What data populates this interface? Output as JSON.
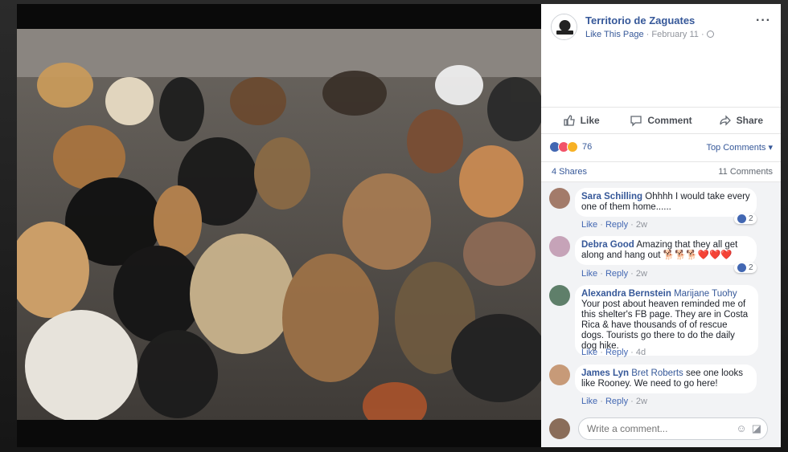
{
  "post": {
    "page_name": "Territorio de Zaguates",
    "like_page": "Like This Page",
    "date": "February 11",
    "sep": "·",
    "more": "···"
  },
  "actions": {
    "like": "Like",
    "comment": "Comment",
    "share": "Share"
  },
  "reactions": {
    "count": "76",
    "top_comments": "Top Comments ▾",
    "shares": "4 Shares",
    "comments_count": "11 Comments"
  },
  "comments": [
    {
      "name": "Sara Schilling",
      "mention": "",
      "text": "Ohhhh I would take every one of them home......",
      "like": "Like",
      "reply": "Reply",
      "age": "2w",
      "reactions": "2"
    },
    {
      "name": "Debra Good",
      "mention": "",
      "text": "Amazing that they all get along and hang out 🐕🐕🐕❤️❤️❤️",
      "like": "Like",
      "reply": "Reply",
      "age": "2w",
      "reactions": "2"
    },
    {
      "name": "Alexandra Bernstein",
      "mention": "Marijane Tuohy",
      "text": "Your post about heaven reminded me of this shelter's FB page. They are in Costa Rica & have thousands of of rescue dogs. Tourists go there to do the daily dog hike.",
      "like": "Like",
      "reply": "Reply",
      "age": "4d"
    },
    {
      "name": "James Lyn",
      "mention": "Bret Roberts",
      "text": "see one looks like Rooney. We need to go here!",
      "like": "Like",
      "reply": "Reply",
      "age": "2w"
    }
  ],
  "composer": {
    "placeholder": "Write a comment..."
  },
  "colors": {
    "link": "#365899",
    "like_blue": "#4267b2",
    "love_red": "#f25268",
    "haha_yellow": "#f7b125"
  },
  "icons": [
    "thumbs-up-icon",
    "comment-icon",
    "share-icon",
    "globe-icon",
    "emoji-icon",
    "sticker-icon"
  ]
}
